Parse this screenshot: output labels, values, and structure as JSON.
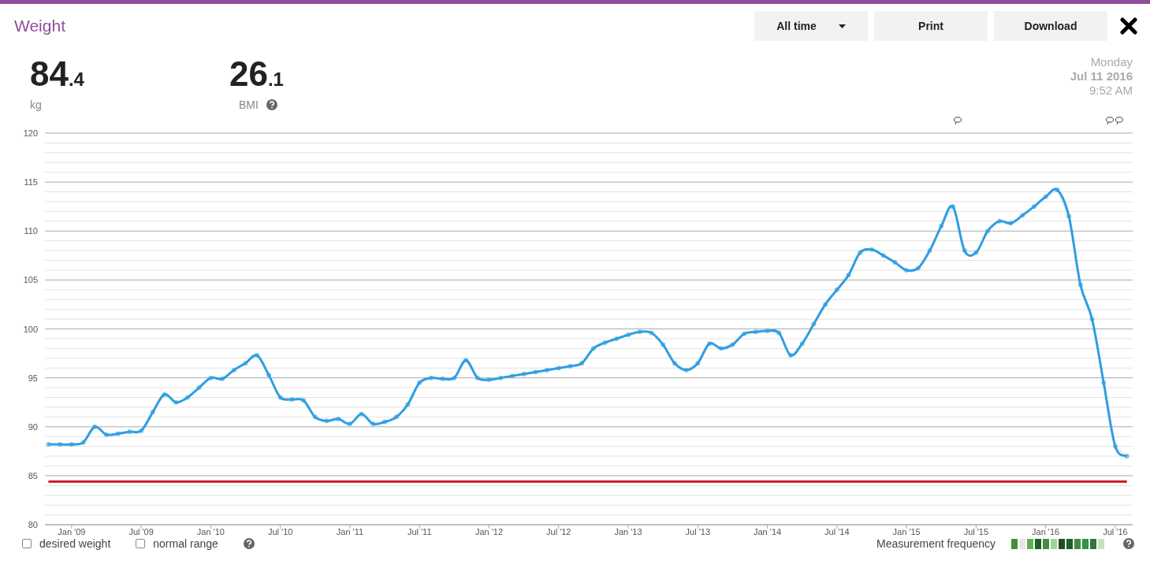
{
  "header": {
    "title": "Weight",
    "range_select": {
      "value": "All time"
    },
    "buttons": [
      "Print",
      "Download"
    ]
  },
  "stats": {
    "weight": {
      "whole": "84",
      "decimal": ".4",
      "unit": "kg"
    },
    "bmi": {
      "whole": "26",
      "decimal": ".1",
      "label": "BMI"
    }
  },
  "date": {
    "weekday": "Monday",
    "date": "Jul 11 2016",
    "time": "9:52 AM"
  },
  "chart_data": {
    "type": "line",
    "categories": [
      null,
      null,
      "Jan '09",
      null,
      null,
      null,
      null,
      null,
      "Jul '09",
      null,
      null,
      null,
      null,
      null,
      "Jan '10",
      null,
      null,
      null,
      null,
      null,
      "Jul '10",
      null,
      null,
      null,
      null,
      null,
      "Jan '11",
      null,
      null,
      null,
      null,
      null,
      "Jul '11",
      null,
      null,
      null,
      null,
      null,
      "Jan '12",
      null,
      null,
      null,
      null,
      null,
      "Jul '12",
      null,
      null,
      null,
      null,
      null,
      "Jan '13",
      null,
      null,
      null,
      null,
      null,
      "Jul '13",
      null,
      null,
      null,
      null,
      null,
      "Jan '14",
      null,
      null,
      null,
      null,
      null,
      "Jul '14",
      null,
      null,
      null,
      null,
      null,
      "Jan '15",
      null,
      null,
      null,
      null,
      null,
      "Jul '15",
      null,
      null,
      null,
      null,
      null,
      "Jan '16",
      null,
      null,
      null,
      null,
      null,
      "Jul '16",
      null
    ],
    "grid": true,
    "series": [
      {
        "color": "#2f9ee0",
        "marker": true,
        "values": [
          88.2,
          88.2,
          88.2,
          88.4,
          90.0,
          89.2,
          89.3,
          89.5,
          89.6,
          91.5,
          93.3,
          92.5,
          93.0,
          94.0,
          95.0,
          94.9,
          95.8,
          96.5,
          97.3,
          95.3,
          93.0,
          92.8,
          92.7,
          91.0,
          90.6,
          90.8,
          90.3,
          91.3,
          90.3,
          90.5,
          91.0,
          92.3,
          94.5,
          95.0,
          94.9,
          95.0,
          96.8,
          95.0,
          94.8,
          95.0,
          95.2,
          95.4,
          95.6,
          95.8,
          96.0,
          96.2,
          96.5,
          98.0,
          98.6,
          99.0,
          99.4,
          99.7,
          99.6,
          98.4,
          96.5,
          95.8,
          96.5,
          98.5,
          98.0,
          98.4,
          99.5,
          99.7,
          99.8,
          99.6,
          97.3,
          98.5,
          100.5,
          102.5,
          104.0,
          105.5,
          107.8,
          108.1,
          107.5,
          106.8,
          106.0,
          106.2,
          108.0,
          110.5,
          112.5,
          108.0,
          107.8,
          110.0,
          111.0,
          110.8,
          111.6,
          112.5,
          113.5,
          114.2,
          111.5,
          104.5,
          101.0,
          94.5,
          88.0,
          87.0
        ]
      },
      {
        "color": "#c8161d",
        "marker": false,
        "values": [
          84.4,
          84.4,
          84.4,
          84.4,
          84.4,
          84.4,
          84.4,
          84.4,
          84.4,
          84.4,
          84.4,
          84.4,
          84.4,
          84.4,
          84.4,
          84.4,
          84.4,
          84.4,
          84.4,
          84.4,
          84.4,
          84.4,
          84.4,
          84.4,
          84.4,
          84.4,
          84.4,
          84.4,
          84.4,
          84.4,
          84.4,
          84.4,
          84.4,
          84.4,
          84.4,
          84.4,
          84.4,
          84.4,
          84.4,
          84.4,
          84.4,
          84.4,
          84.4,
          84.4,
          84.4,
          84.4,
          84.4,
          84.4,
          84.4,
          84.4,
          84.4,
          84.4,
          84.4,
          84.4,
          84.4,
          84.4,
          84.4,
          84.4,
          84.4,
          84.4,
          84.4,
          84.4,
          84.4,
          84.4,
          84.4,
          84.4,
          84.4,
          84.4,
          84.4,
          84.4,
          84.4,
          84.4,
          84.4,
          84.4,
          84.4,
          84.4,
          84.4,
          84.4,
          84.4,
          84.4,
          84.4,
          84.4,
          84.4,
          84.4,
          84.4,
          84.4,
          84.4,
          84.4,
          84.4,
          84.4,
          84.4,
          84.4,
          84.4,
          84.4
        ]
      }
    ],
    "ylim": [
      80,
      120
    ],
    "yticks": [
      80,
      85,
      90,
      95,
      100,
      105,
      110,
      115,
      120
    ]
  },
  "options": [
    {
      "label": "desired weight",
      "checked": false
    },
    {
      "label": "normal range",
      "checked": false
    }
  ],
  "frequency": {
    "label": "Measurement frequency",
    "cells": [
      {
        "color": "#3d8f40"
      },
      {
        "color": "#e6e6e6"
      },
      {
        "color": "#5caf5c"
      },
      {
        "color": "#1f5f24"
      },
      {
        "color": "#3d8f40"
      },
      {
        "color": "#9dd397"
      },
      {
        "color": "#1a5220"
      },
      {
        "color": "#1f5f24"
      },
      {
        "color": "#3d8f40"
      },
      {
        "color": "#3d8f40"
      },
      {
        "color": "#2f7a35"
      },
      {
        "color": "#c4e4bf"
      }
    ]
  }
}
